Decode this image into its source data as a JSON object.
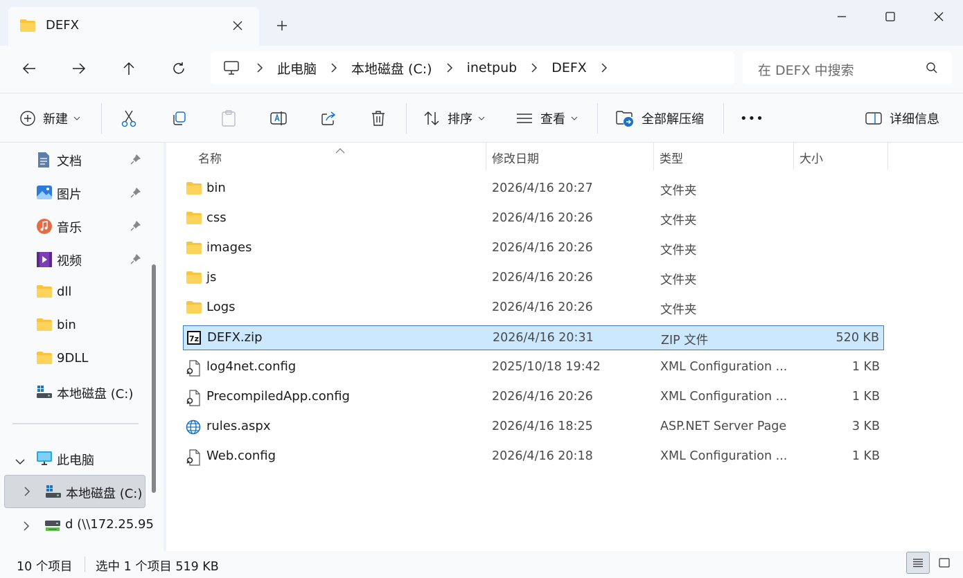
{
  "window": {
    "tab_title": "DEFX",
    "icons": {
      "minimize": "minimize-icon",
      "maximize": "maximize-icon",
      "close": "close-icon"
    }
  },
  "address": {
    "crumbs": [
      "此电脑",
      "本地磁盘 (C:)",
      "inetpub",
      "DEFX"
    ],
    "search_placeholder": "在 DEFX 中搜索"
  },
  "toolbar": {
    "new_label": "新建",
    "sort_label": "排序",
    "view_label": "查看",
    "extract_label": "全部解压缩",
    "more_label": "•••",
    "details_label": "详细信息"
  },
  "sidebar": {
    "quick": [
      {
        "label": "文档",
        "icon": "documents-icon",
        "pinned": true
      },
      {
        "label": "图片",
        "icon": "pictures-icon",
        "pinned": true
      },
      {
        "label": "音乐",
        "icon": "music-icon",
        "pinned": true
      },
      {
        "label": "视频",
        "icon": "videos-icon",
        "pinned": true
      },
      {
        "label": "dll",
        "icon": "folder-icon",
        "pinned": false
      },
      {
        "label": "bin",
        "icon": "folder-icon",
        "pinned": false
      },
      {
        "label": "9DLL",
        "icon": "folder-icon",
        "pinned": false
      },
      {
        "label": "本地磁盘 (C:)",
        "icon": "drive-icon",
        "pinned": false
      }
    ],
    "this_pc": "此电脑",
    "drive_c": "本地磁盘 (C:)",
    "drive_d": "d (\\\\172.25.95"
  },
  "columns": {
    "name": "名称",
    "date": "修改日期",
    "type": "类型",
    "size": "大小"
  },
  "files": [
    {
      "name": "bin",
      "date": "2026/4/16 20:27",
      "type": "文件夹",
      "size": "",
      "icon": "folder-icon"
    },
    {
      "name": "css",
      "date": "2026/4/16 20:26",
      "type": "文件夹",
      "size": "",
      "icon": "folder-icon"
    },
    {
      "name": "images",
      "date": "2026/4/16 20:26",
      "type": "文件夹",
      "size": "",
      "icon": "folder-icon"
    },
    {
      "name": "js",
      "date": "2026/4/16 20:26",
      "type": "文件夹",
      "size": "",
      "icon": "folder-icon"
    },
    {
      "name": "Logs",
      "date": "2026/4/16 20:26",
      "type": "文件夹",
      "size": "",
      "icon": "folder-icon"
    },
    {
      "name": "DEFX.zip",
      "date": "2026/4/16 20:31",
      "type": "ZIP 文件",
      "size": "520 KB",
      "icon": "zip-file-icon",
      "selected": true
    },
    {
      "name": "log4net.config",
      "date": "2025/10/18 19:42",
      "type": "XML Configuration ...",
      "size": "1 KB",
      "icon": "config-file-icon"
    },
    {
      "name": "PrecompiledApp.config",
      "date": "2026/4/16 20:26",
      "type": "XML Configuration ...",
      "size": "1 KB",
      "icon": "config-file-icon"
    },
    {
      "name": "rules.aspx",
      "date": "2026/4/16 18:25",
      "type": "ASP.NET Server Page",
      "size": "3 KB",
      "icon": "web-page-icon"
    },
    {
      "name": "Web.config",
      "date": "2026/4/16 20:18",
      "type": "XML Configuration ...",
      "size": "1 KB",
      "icon": "config-file-icon"
    }
  ],
  "status": {
    "count": "10 个项目",
    "selection": "选中 1 个项目  519 KB"
  },
  "colors": {
    "selection_bg": "#cce8ff",
    "selection_border": "#3c79c8",
    "folder_yellow": "#f8c43a",
    "accent_blue": "#1a73c9"
  }
}
